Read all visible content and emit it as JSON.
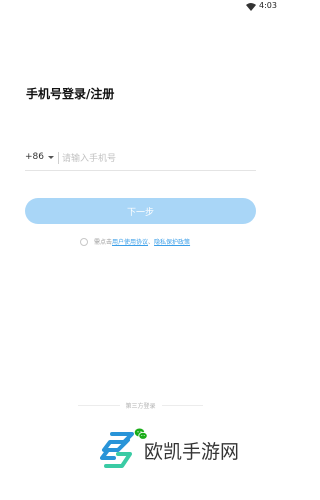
{
  "status_bar": {
    "time": "4:03"
  },
  "login": {
    "title": "手机号登录/注册",
    "country_code": "+86",
    "phone_placeholder": "请输入手机号",
    "next_button": "下一步"
  },
  "agreement": {
    "prefix": "需点击",
    "user_agreement": "用户使用协议",
    "separator": "、",
    "privacy_policy": "隐私保护政策"
  },
  "third_party": {
    "label": "第三方登录",
    "icons": [
      "wechat-icon"
    ]
  },
  "watermark": {
    "text": "欧凯手游网"
  },
  "colors": {
    "button_bg": "#a9d6f7",
    "link": "#3a9ee8",
    "wechat": "#1aad19"
  }
}
